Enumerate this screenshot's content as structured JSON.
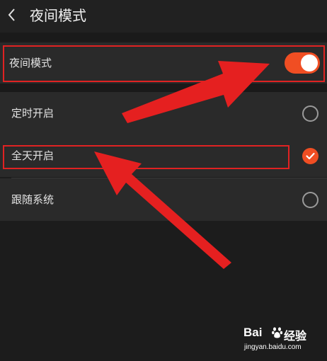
{
  "header": {
    "title": "夜间模式",
    "back_icon": "chevron-left-icon"
  },
  "settings": {
    "night_mode": {
      "label": "夜间模式",
      "enabled": true
    },
    "options": [
      {
        "label": "定时开启",
        "selected": false
      },
      {
        "label": "全天开启",
        "selected": true
      },
      {
        "label": "跟随系统",
        "selected": false
      }
    ]
  },
  "watermark": {
    "logo_text": "Bai",
    "logo_cn": "经验",
    "url": "jingyan.baidu.com"
  },
  "colors": {
    "accent": "#f04e23",
    "annotation": "#e02222",
    "background": "#1c1c1c",
    "row": "#2a2a2a"
  }
}
